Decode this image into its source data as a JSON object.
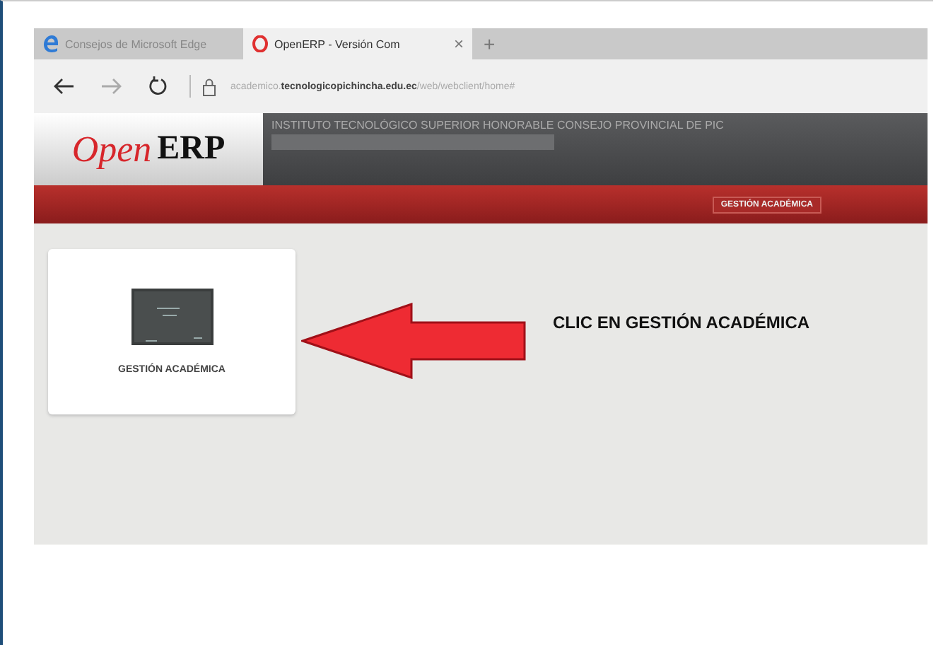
{
  "browser": {
    "tabs": [
      {
        "label": "Consejos de Microsoft Edge",
        "selected": false,
        "kind": "edge"
      },
      {
        "label": "OpenERP - Versión Com",
        "selected": true,
        "kind": "opera"
      }
    ],
    "new_tab": "+",
    "close": "×",
    "address": "academico.**tecnologicopichincha.edu.ec**/web/webclient/home#"
  },
  "header": {
    "logo_open": "Open",
    "logo_erp": "ERP",
    "company": "INSTITUTO TECNOLÓGICO SUPERIOR HONORABLE CONSEJO PROVINCIAL DE PIC"
  },
  "menu": [
    {
      "label": "GESTIÓN ACADÉMICA",
      "selected": true
    }
  ],
  "apps": [
    {
      "label": "GESTIÓN ACADÉMICA"
    }
  ],
  "annotation": "CLIC EN GESTIÓN ACADÉMICA"
}
